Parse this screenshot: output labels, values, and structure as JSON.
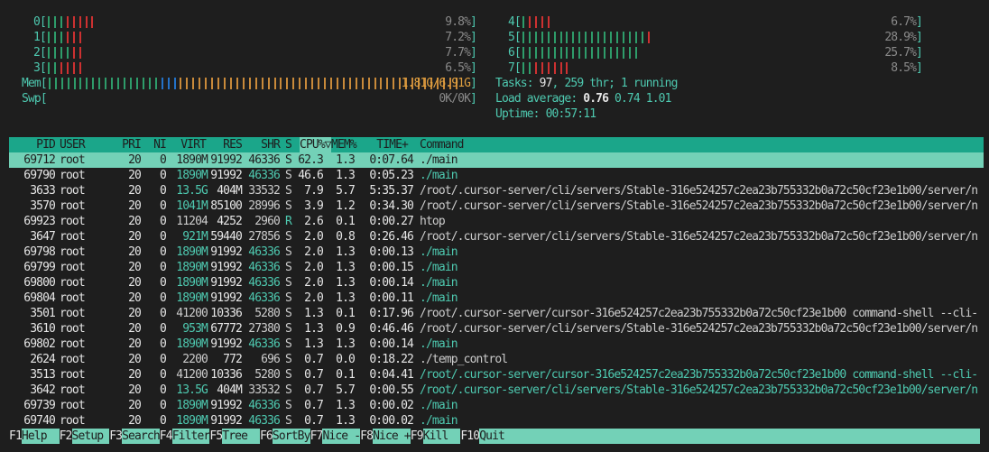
{
  "cpus_left": [
    {
      "id": "0",
      "percent": "9.8%",
      "bars": "gggrrrrr"
    },
    {
      "id": "1",
      "percent": "7.2%",
      "bars": "gggrrr"
    },
    {
      "id": "2",
      "percent": "7.7%",
      "bars": "ggggrr"
    },
    {
      "id": "3",
      "percent": "6.5%",
      "bars": "ggrrrr"
    }
  ],
  "cpus_right": [
    {
      "id": "4",
      "percent": "6.7%",
      "bars": "grrrr"
    },
    {
      "id": "5",
      "percent": "28.9%",
      "bars": "ggggggggggggggggggggr"
    },
    {
      "id": "6",
      "percent": "25.7%",
      "bars": "ggggggggggggggggggg"
    },
    {
      "id": "7",
      "percent": "8.5%",
      "bars": "ggrrrrrr"
    }
  ],
  "mem": {
    "label": "Mem",
    "value": "1.81G/6.91G",
    "bars": "ggggggggggggggggggbbbooooooooooooooooooooooooooooooooooooooooooooo"
  },
  "swp": {
    "label": "Swp",
    "value": "0K/0K"
  },
  "tasks": {
    "label": "Tasks: ",
    "count": "97",
    "sep": ", ",
    "threads": "259",
    "thr_label": " thr; ",
    "running": "1",
    "running_label": " running"
  },
  "load": {
    "label": "Load average: ",
    "l1": "0.76",
    "l5": "0.74",
    "l15": "1.01"
  },
  "uptime": {
    "label": "Uptime: ",
    "value": "00:57:11"
  },
  "colors": {
    "header_bg": "#1ba68a",
    "selected_bg": "#73d1b7",
    "cpu_normal": "#2e9c6a",
    "cpu_kernel": "#cd3131",
    "mem_buffers": "#2472c8",
    "mem_cache": "#c98a3a"
  },
  "columns": {
    "pid": "PID",
    "user": "USER",
    "pri": "PRI",
    "ni": "NI",
    "virt": "VIRT",
    "res": "RES",
    "shr": "SHR",
    "s": "S",
    "cpu": "CPU%▽",
    "mem": "MEM%",
    "time": "TIME+",
    "command": "Command"
  },
  "processes": [
    {
      "pid": "69712",
      "user": "root",
      "pri": "20",
      "ni": "0",
      "virt": "1890M",
      "res": "91992",
      "shr": "46336",
      "s": "S",
      "cpu": "62.3",
      "mem": "1.3",
      "time": "0:07.64",
      "command": "./main",
      "thread": true,
      "selected": true
    },
    {
      "pid": "69790",
      "user": "root",
      "pri": "20",
      "ni": "0",
      "virt": "1890M",
      "res": "91992",
      "shr": "46336",
      "s": "S",
      "cpu": "46.6",
      "mem": "1.3",
      "time": "0:05.23",
      "command": "./main",
      "thread": true
    },
    {
      "pid": "3633",
      "user": "root",
      "pri": "20",
      "ni": "0",
      "virt": "13.5G",
      "res": "404M",
      "shr": "33532",
      "s": "S",
      "cpu": "7.9",
      "mem": "5.7",
      "time": "5:35.37",
      "command": "/root/.cursor-server/cli/servers/Stable-316e524257c2ea23b755332b0a72c50cf23e1b00/server/n",
      "thread": false
    },
    {
      "pid": "3570",
      "user": "root",
      "pri": "20",
      "ni": "0",
      "virt": "1041M",
      "res": "85100",
      "shr": "28996",
      "s": "S",
      "cpu": "3.9",
      "mem": "1.2",
      "time": "0:34.30",
      "command": "/root/.cursor-server/cli/servers/Stable-316e524257c2ea23b755332b0a72c50cf23e1b00/server/n",
      "thread": false
    },
    {
      "pid": "69923",
      "user": "root",
      "pri": "20",
      "ni": "0",
      "virt": "11204",
      "res": "4252",
      "shr": "2960",
      "s": "R",
      "cpu": "2.6",
      "mem": "0.1",
      "time": "0:00.27",
      "command": "htop",
      "thread": false
    },
    {
      "pid": "3647",
      "user": "root",
      "pri": "20",
      "ni": "0",
      "virt": "921M",
      "res": "59440",
      "shr": "27856",
      "s": "S",
      "cpu": "2.0",
      "mem": "0.8",
      "time": "0:26.46",
      "command": "/root/.cursor-server/cli/servers/Stable-316e524257c2ea23b755332b0a72c50cf23e1b00/server/n",
      "thread": false
    },
    {
      "pid": "69798",
      "user": "root",
      "pri": "20",
      "ni": "0",
      "virt": "1890M",
      "res": "91992",
      "shr": "46336",
      "s": "S",
      "cpu": "2.0",
      "mem": "1.3",
      "time": "0:00.13",
      "command": "./main",
      "thread": true
    },
    {
      "pid": "69799",
      "user": "root",
      "pri": "20",
      "ni": "0",
      "virt": "1890M",
      "res": "91992",
      "shr": "46336",
      "s": "S",
      "cpu": "2.0",
      "mem": "1.3",
      "time": "0:00.15",
      "command": "./main",
      "thread": true
    },
    {
      "pid": "69800",
      "user": "root",
      "pri": "20",
      "ni": "0",
      "virt": "1890M",
      "res": "91992",
      "shr": "46336",
      "s": "S",
      "cpu": "2.0",
      "mem": "1.3",
      "time": "0:00.14",
      "command": "./main",
      "thread": true
    },
    {
      "pid": "69804",
      "user": "root",
      "pri": "20",
      "ni": "0",
      "virt": "1890M",
      "res": "91992",
      "shr": "46336",
      "s": "S",
      "cpu": "2.0",
      "mem": "1.3",
      "time": "0:00.11",
      "command": "./main",
      "thread": true
    },
    {
      "pid": "3501",
      "user": "root",
      "pri": "20",
      "ni": "0",
      "virt": "41200",
      "res": "10336",
      "shr": "5280",
      "s": "S",
      "cpu": "1.3",
      "mem": "0.1",
      "time": "0:17.96",
      "command": "/root/.cursor-server/cursor-316e524257c2ea23b755332b0a72c50cf23e1b00 command-shell --cli-",
      "thread": false
    },
    {
      "pid": "3610",
      "user": "root",
      "pri": "20",
      "ni": "0",
      "virt": "953M",
      "res": "67772",
      "shr": "27380",
      "s": "S",
      "cpu": "1.3",
      "mem": "0.9",
      "time": "0:46.46",
      "command": "/root/.cursor-server/cli/servers/Stable-316e524257c2ea23b755332b0a72c50cf23e1b00/server/n",
      "thread": false
    },
    {
      "pid": "69802",
      "user": "root",
      "pri": "20",
      "ni": "0",
      "virt": "1890M",
      "res": "91992",
      "shr": "46336",
      "s": "S",
      "cpu": "1.3",
      "mem": "1.3",
      "time": "0:00.14",
      "command": "./main",
      "thread": true
    },
    {
      "pid": "2624",
      "user": "root",
      "pri": "20",
      "ni": "0",
      "virt": "2200",
      "res": "772",
      "shr": "696",
      "s": "S",
      "cpu": "0.7",
      "mem": "0.0",
      "time": "0:18.22",
      "command": "./temp_control",
      "thread": false
    },
    {
      "pid": "3513",
      "user": "root",
      "pri": "20",
      "ni": "0",
      "virt": "41200",
      "res": "10336",
      "shr": "5280",
      "s": "S",
      "cpu": "0.7",
      "mem": "0.1",
      "time": "0:04.41",
      "command": "/root/.cursor-server/cursor-316e524257c2ea23b755332b0a72c50cf23e1b00 command-shell --cli-",
      "thread": true
    },
    {
      "pid": "3642",
      "user": "root",
      "pri": "20",
      "ni": "0",
      "virt": "13.5G",
      "res": "404M",
      "shr": "33532",
      "s": "S",
      "cpu": "0.7",
      "mem": "5.7",
      "time": "0:00.55",
      "command": "/root/.cursor-server/cli/servers/Stable-316e524257c2ea23b755332b0a72c50cf23e1b00/server/n",
      "thread": true
    },
    {
      "pid": "69739",
      "user": "root",
      "pri": "20",
      "ni": "0",
      "virt": "1890M",
      "res": "91992",
      "shr": "46336",
      "s": "S",
      "cpu": "0.7",
      "mem": "1.3",
      "time": "0:00.02",
      "command": "./main",
      "thread": true
    },
    {
      "pid": "69740",
      "user": "root",
      "pri": "20",
      "ni": "0",
      "virt": "1890M",
      "res": "91992",
      "shr": "46336",
      "s": "S",
      "cpu": "0.7",
      "mem": "1.3",
      "time": "0:00.02",
      "command": "./main",
      "thread": true
    }
  ],
  "footer": [
    {
      "key": "F1",
      "label": "Help  "
    },
    {
      "key": "F2",
      "label": "Setup "
    },
    {
      "key": "F3",
      "label": "Search"
    },
    {
      "key": "F4",
      "label": "Filter"
    },
    {
      "key": "F5",
      "label": "Tree  "
    },
    {
      "key": "F6",
      "label": "SortBy"
    },
    {
      "key": "F7",
      "label": "Nice -"
    },
    {
      "key": "F8",
      "label": "Nice +"
    },
    {
      "key": "F9",
      "label": "Kill  "
    },
    {
      "key": "F10",
      "label": "Quit"
    }
  ]
}
